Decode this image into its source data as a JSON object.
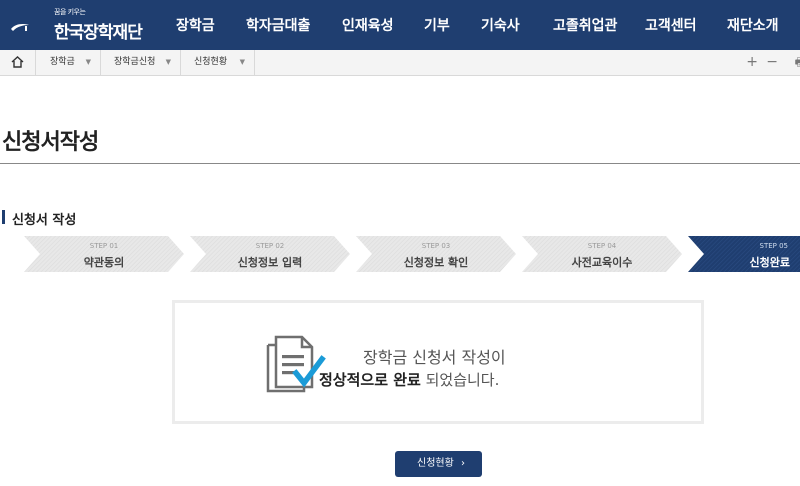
{
  "header": {
    "logo_tagline": "꿈을 키우는",
    "logo_name": "한국장학재단",
    "menu": [
      "장학금",
      "학자금대출",
      "인재육성",
      "기부",
      "기숙사",
      "고졸취업관",
      "고객센터",
      "재단소개"
    ]
  },
  "breadcrumb": {
    "home_icon": "home-icon",
    "items": [
      "장학금",
      "장학금신청",
      "신청현황"
    ],
    "tools": [
      "+",
      "−",
      "🖶"
    ]
  },
  "page": {
    "title": "신청서작성",
    "section_title": "신청서 작성"
  },
  "steps": [
    {
      "num": "STEP 01",
      "label": "약관동의"
    },
    {
      "num": "STEP 02",
      "label": "신청정보 입력"
    },
    {
      "num": "STEP 03",
      "label": "신청정보 확인"
    },
    {
      "num": "STEP 04",
      "label": "사전교육이수"
    },
    {
      "num": "STEP 05",
      "label": "신청완료"
    }
  ],
  "completion": {
    "line1": "장학금 신청서 작성이",
    "line2_bold": "정상적으로 완료",
    "line2_rest": " 되었습니다."
  },
  "actions": {
    "status_label": "신청현황",
    "status_chevron": "›"
  },
  "colors": {
    "navy": "#1f3e70",
    "step_inactive": "#e6e6e6",
    "icon_blue": "#1b9bd7"
  }
}
